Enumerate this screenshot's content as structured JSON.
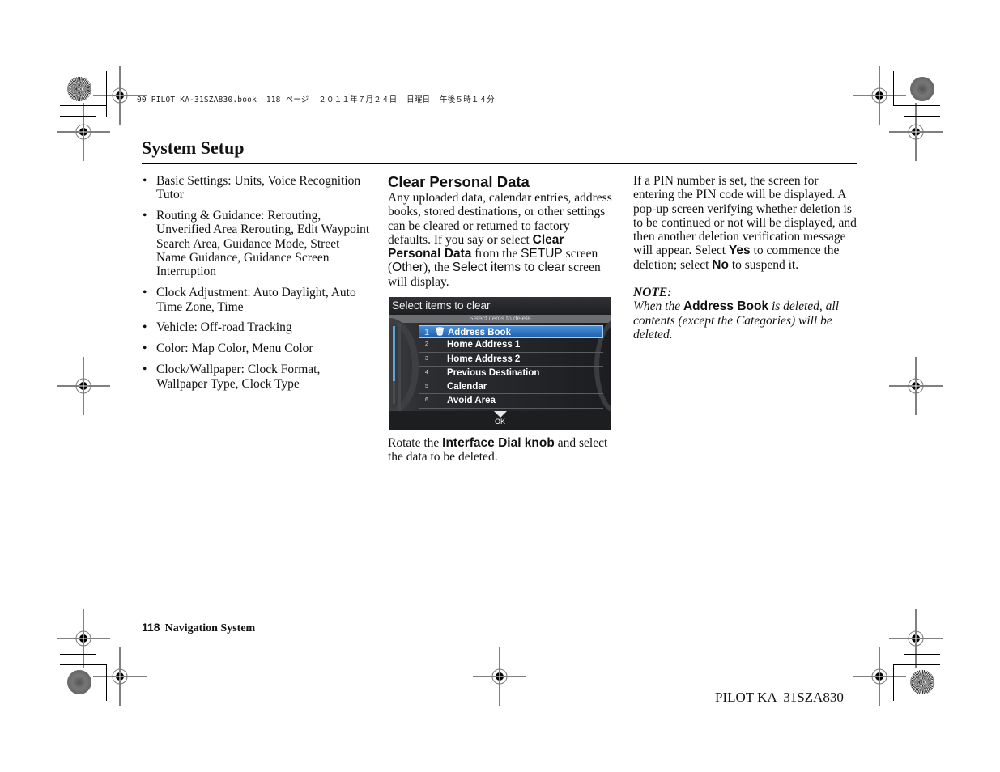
{
  "slug": {
    "filename": "00 PILOT_KA-31SZA830.book",
    "page": "118",
    "page_word": "ページ",
    "date": "２０１１年７月２４日",
    "weekday": "日曜日",
    "time": "午後５時１４分"
  },
  "header": {
    "title": "System Setup"
  },
  "left_column": {
    "bullets": [
      "Basic Settings: Units, Voice Recognition Tutor",
      "Routing & Guidance: Rerouting, Unverified Area Rerouting, Edit Waypoint Search Area, Guidance Mode, Street Name Guidance, Guidance Screen Interruption",
      "Clock Adjustment: Auto Daylight, Auto Time Zone, Time",
      "Vehicle: Off-road Tracking",
      "Color: Map Color, Menu Color",
      "Clock/Wallpaper: Clock Format, Wallpaper Type, Clock Type"
    ]
  },
  "middle_column": {
    "heading": "Clear Personal Data",
    "intro": {
      "t1": "Any uploaded data, calendar entries, address books, stored destinations, or other settings can be cleared or returned to factory defaults. If you say or select ",
      "b1": "Clear Personal Data",
      "t2": " from the ",
      "s1": "SETUP",
      "t3": " screen (",
      "s2": "Other",
      "t4": "), the ",
      "s3": "Select items to clear",
      "t5": " screen will display."
    },
    "screen": {
      "title": "Select items to clear",
      "subtitle": "Select items to delete",
      "items": [
        {
          "num": "1",
          "label": "Address Book",
          "selected": true,
          "icon": "trash-icon"
        },
        {
          "num": "2",
          "label": "Home Address 1"
        },
        {
          "num": "3",
          "label": "Home Address 2"
        },
        {
          "num": "4",
          "label": "Previous Destination"
        },
        {
          "num": "5",
          "label": "Calendar"
        },
        {
          "num": "6",
          "label": "Avoid Area"
        }
      ],
      "ok_label": "OK"
    },
    "after": {
      "t1": "Rotate the ",
      "b1": "Interface Dial knob",
      "t2": " and select the data to be deleted."
    }
  },
  "right_column": {
    "p1": {
      "t1": "If a PIN number is set, the screen for entering the PIN code will be displayed. A pop-up screen verifying whether deletion is to be continued or not will be displayed, and then another deletion verification message will appear. Select ",
      "b1": "Yes",
      "t2": " to commence the deletion; select ",
      "b2": "No",
      "t3": " to suspend it."
    },
    "note_label": "NOTE:",
    "note": {
      "t1": "When the ",
      "b1": "Address Book",
      "t2": " is deleted, all contents (except the Categories) will be deleted."
    }
  },
  "footer": {
    "page_number": "118",
    "section": "Navigation System",
    "model": "PILOT KA  31SZA830"
  }
}
